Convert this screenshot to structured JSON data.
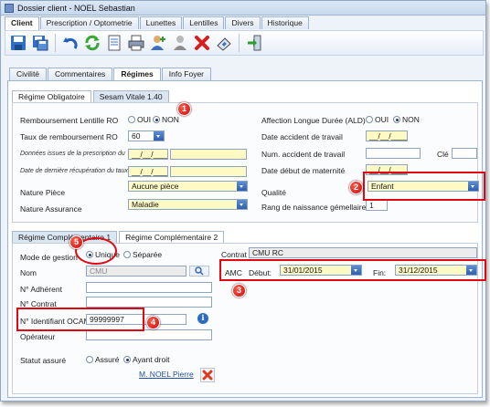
{
  "window": {
    "title": "Dossier client - NOEL Sebastian"
  },
  "main_tabs": [
    "Client",
    "Prescription / Optometrie",
    "Lunettes",
    "Lentilles",
    "Divers",
    "Historique"
  ],
  "toolbar_icons": [
    "save-icon",
    "save-all-icon",
    "undo-icon",
    "refresh-icon",
    "document-icon",
    "print-icon",
    "add-user-icon",
    "user-icon",
    "delete-icon",
    "scan-card-icon",
    "exit-icon"
  ],
  "sub_tabs": [
    "Civilité",
    "Commentaires",
    "Régimes",
    "Info Foyer"
  ],
  "ro_tabs": [
    "Régime Obligatoire",
    "Sesam Vitale 1.40"
  ],
  "ro": {
    "remboursement_label": "Remboursement Lentille RO",
    "oui": "OUI",
    "non": "NON",
    "taux_label": "Taux de remboursement RO",
    "taux_value": "60",
    "donnees_label": "Données issues de la prescription du",
    "donnees_value": "__/__/____",
    "recup_label": "Date de dernière récupération du taux",
    "recup_value": "__/__/____",
    "nature_piece_label": "Nature Pièce",
    "nature_piece_value": "Aucune pièce",
    "nature_assurance_label": "Nature Assurance",
    "nature_assurance_value": "Maladie",
    "ald_label": "Affection Longue Durée (ALD)",
    "ald_oui": "OUI",
    "ald_non": "NON",
    "date_accident_label": "Date accident de travail",
    "date_accident_value": "__/__/____",
    "num_accident_label": "Num. accident de travail",
    "cle_label": "Clé",
    "maternite_label": "Date début de maternité",
    "maternite_value": "__/__/____",
    "qualite_label": "Qualité",
    "qualite_value": "Enfant",
    "rang_label": "Rang de naissance gémellaire",
    "rang_value": "1"
  },
  "rc_tabs": [
    "Régime Complémentaire 1",
    "Régime Complémentaire 2"
  ],
  "rc": {
    "mode_label": "Mode de gestion",
    "unique": "Unique",
    "separee": "Séparée",
    "contrat_label": "Contrat",
    "contrat_value": "CMU RC",
    "nom_label": "Nom",
    "nom_value": "CMU",
    "amc_label": "AMC",
    "debut_label": "Début:",
    "debut_value": "31/01/2015",
    "fin_label": "Fin:",
    "fin_value": "31/12/2015",
    "adherent_label": "N° Adhérent",
    "contrat_num_label": "N° Contrat",
    "ocam_label": "N° Identifiant OCAM",
    "ocam_value": "99999997",
    "operateur_label": "Opérateur",
    "statut_label": "Statut assuré",
    "assure": "Assuré",
    "ayant_droit": "Ayant droit",
    "link": "M. NOEL Pierre"
  },
  "badges": [
    "1",
    "2",
    "3",
    "4",
    "5"
  ],
  "colors": {
    "annotation": "#e30613",
    "required_field": "#fff9c4",
    "combo_button": "#2f5fae",
    "tab_border": "#9db3d3"
  }
}
